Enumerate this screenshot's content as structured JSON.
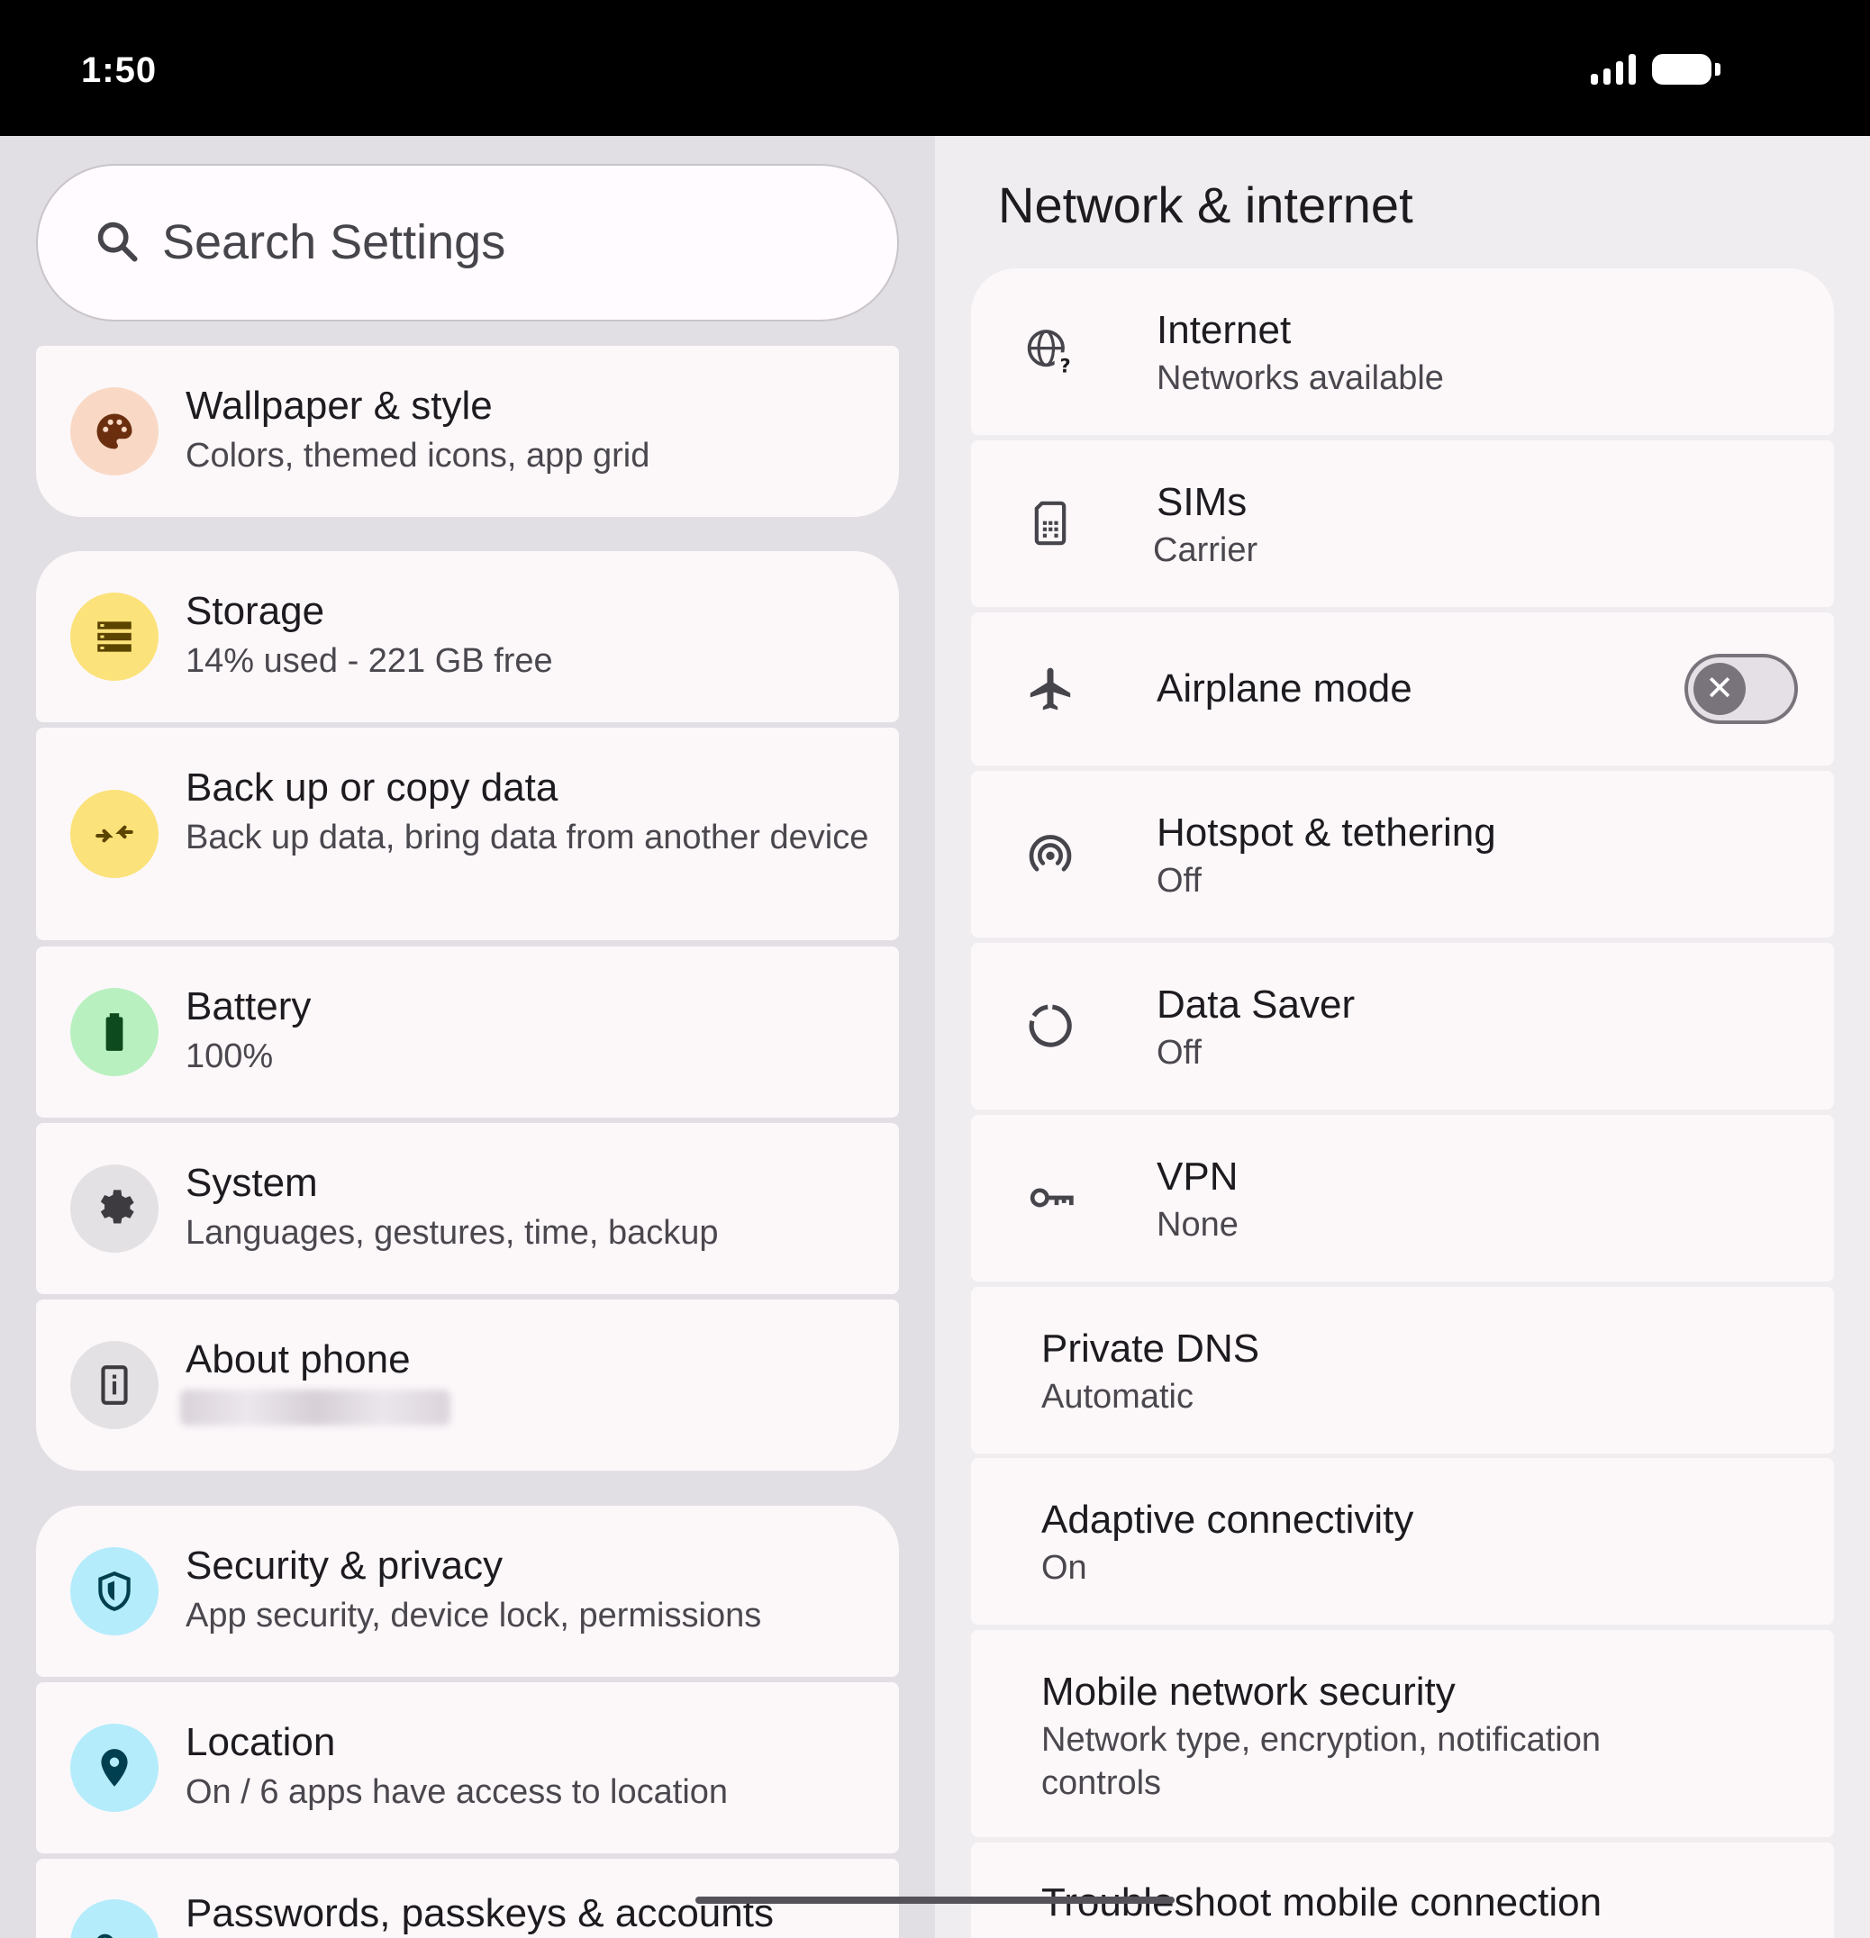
{
  "status_bar": {
    "time": "1:50"
  },
  "search": {
    "placeholder": "Search Settings"
  },
  "left": {
    "items": [
      {
        "title": "Wallpaper & style",
        "subtitle": "Colors, themed icons, app grid",
        "icon": "palette-icon",
        "color": "#f9d9c6"
      },
      {
        "title": "Storage",
        "subtitle": "14% used - 221 GB free",
        "icon": "storage-icon",
        "color": "#fbe27a"
      },
      {
        "title": "Back up or copy data",
        "subtitle": "Back up data, bring data from another device",
        "icon": "transfer-icon",
        "color": "#fbe27a"
      },
      {
        "title": "Battery",
        "subtitle": "100%",
        "icon": "battery-icon",
        "color": "#b8f0c0"
      },
      {
        "title": "System",
        "subtitle": "Languages, gestures, time, backup",
        "icon": "gear-icon",
        "color": "#e3e1e4"
      },
      {
        "title": "About phone",
        "subtitle": "",
        "icon": "info-phone-icon",
        "color": "#e3e1e4"
      },
      {
        "title": "Security & privacy",
        "subtitle": "App security, device lock, permissions",
        "icon": "shield-icon",
        "color": "#b4ecfb"
      },
      {
        "title": "Location",
        "subtitle": "On / 6 apps have access to location",
        "icon": "location-pin-icon",
        "color": "#b4ecfb"
      },
      {
        "title": "Passwords, passkeys & accounts",
        "subtitle": "",
        "icon": "key-icon",
        "color": "#b4ecfb"
      }
    ]
  },
  "right": {
    "title": "Network & internet",
    "items": [
      {
        "title": "Internet",
        "subtitle": "Networks available",
        "icon": "globe-question-icon"
      },
      {
        "title": "SIMs",
        "subtitle": "Carrier",
        "icon": "sim-card-icon"
      },
      {
        "title": "Airplane mode",
        "subtitle": "",
        "icon": "airplane-icon",
        "toggle": false
      },
      {
        "title": "Hotspot & tethering",
        "subtitle": "Off",
        "icon": "hotspot-icon"
      },
      {
        "title": "Data Saver",
        "subtitle": "Off",
        "icon": "data-saver-icon"
      },
      {
        "title": "VPN",
        "subtitle": "None",
        "icon": "vpn-key-icon"
      },
      {
        "title": "Private DNS",
        "subtitle": "Automatic"
      },
      {
        "title": "Adaptive connectivity",
        "subtitle": "On"
      },
      {
        "title": "Mobile network security",
        "subtitle": "Network type, encryption, notification controls"
      },
      {
        "title": "Troubleshoot mobile connection",
        "subtitle": ""
      }
    ]
  },
  "colors": {
    "accent_dark": "#1d1b1f",
    "toggle_off": "#79747c"
  }
}
